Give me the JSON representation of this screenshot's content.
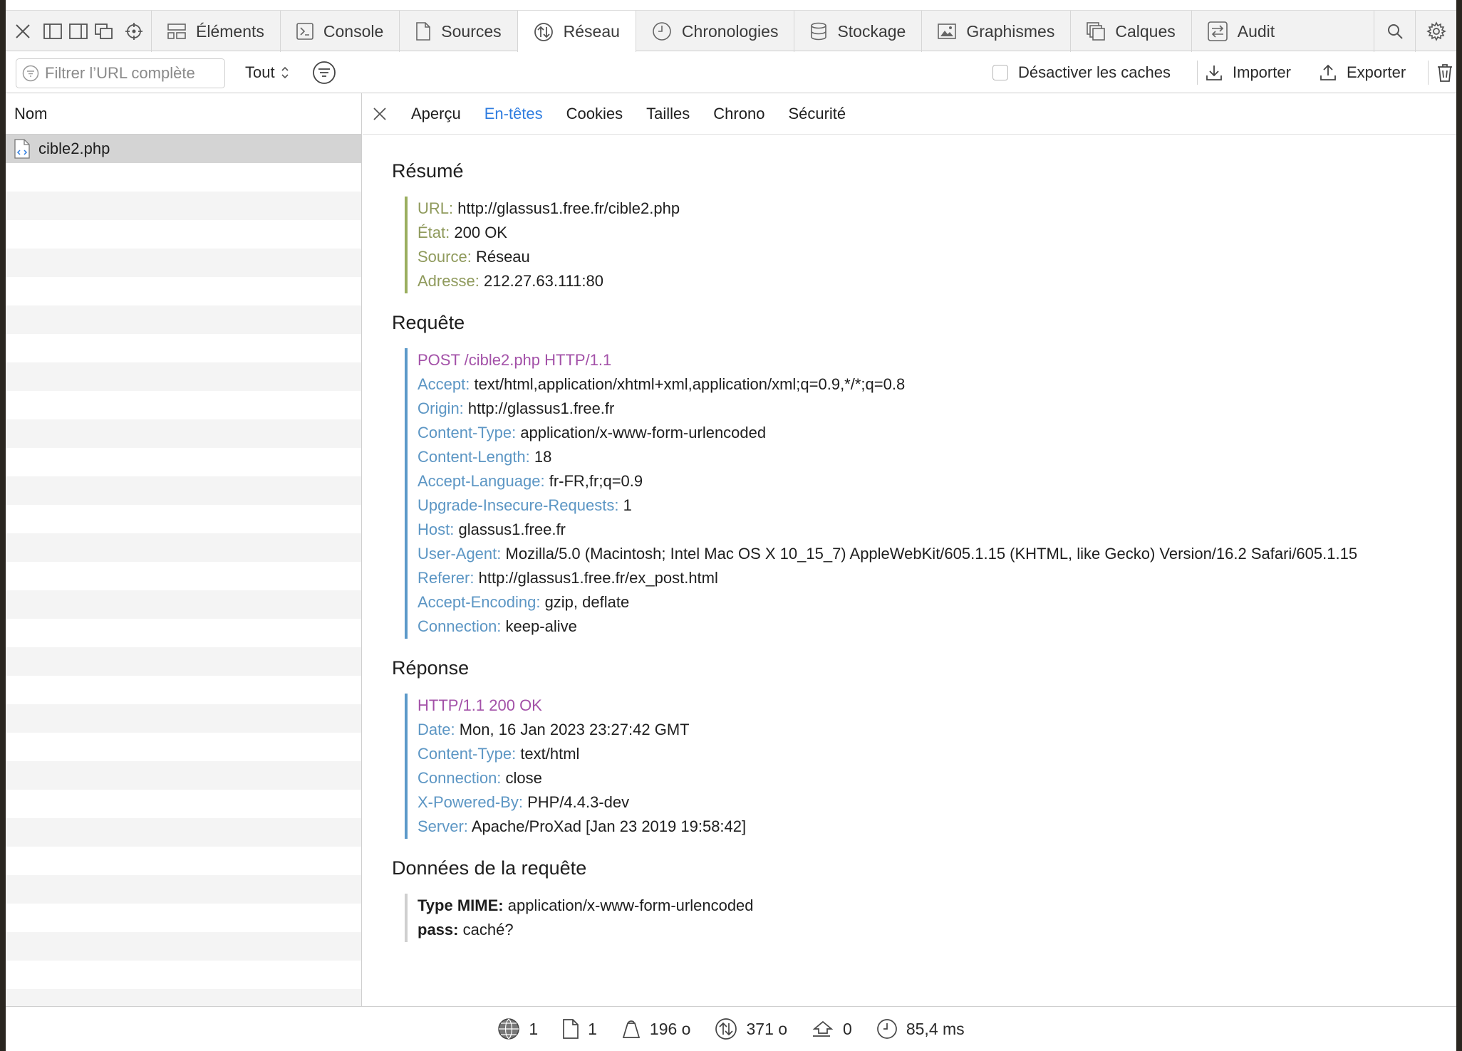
{
  "toolbar": {
    "tabs": [
      {
        "label": "Éléments",
        "icon": "elements-icon"
      },
      {
        "label": "Console",
        "icon": "console-icon"
      },
      {
        "label": "Sources",
        "icon": "sources-icon"
      },
      {
        "label": "Réseau",
        "icon": "network-icon",
        "active": true
      },
      {
        "label": "Chronologies",
        "icon": "timelines-icon"
      },
      {
        "label": "Stockage",
        "icon": "storage-icon"
      },
      {
        "label": "Graphismes",
        "icon": "graphics-icon"
      },
      {
        "label": "Calques",
        "icon": "layers-icon"
      },
      {
        "label": "Audit",
        "icon": "audit-icon"
      }
    ]
  },
  "filterbar": {
    "placeholder": "Filtrer l’URL complète",
    "type_filter": "Tout",
    "disable_cache_label": "Désactiver les caches",
    "import_label": "Importer",
    "export_label": "Exporter"
  },
  "request_list": {
    "header": "Nom",
    "items": [
      {
        "name": "cible2.php"
      }
    ]
  },
  "detail": {
    "tabs": [
      "Aperçu",
      "En-têtes",
      "Cookies",
      "Tailles",
      "Chrono",
      "Sécurité"
    ],
    "active_tab": "En-têtes",
    "summary": {
      "title": "Résumé",
      "rows": [
        {
          "key": "URL:",
          "value": "http://glassus1.free.fr/cible2.php"
        },
        {
          "key": "État:",
          "value": "200 OK"
        },
        {
          "key": "Source:",
          "value": "Réseau"
        },
        {
          "key": "Adresse:",
          "value": "212.27.63.111:80"
        }
      ]
    },
    "request": {
      "title": "Requête",
      "first_line": "POST /cible2.php HTTP/1.1",
      "rows": [
        {
          "key": "Accept:",
          "value": "text/html,application/xhtml+xml,application/xml;q=0.9,*/*;q=0.8"
        },
        {
          "key": "Origin:",
          "value": "http://glassus1.free.fr"
        },
        {
          "key": "Content-Type:",
          "value": "application/x-www-form-urlencoded"
        },
        {
          "key": "Content-Length:",
          "value": "18"
        },
        {
          "key": "Accept-Language:",
          "value": "fr-FR,fr;q=0.9"
        },
        {
          "key": "Upgrade-Insecure-Requests:",
          "value": "1"
        },
        {
          "key": "Host:",
          "value": "glassus1.free.fr"
        },
        {
          "key": "User-Agent:",
          "value": "Mozilla/5.0 (Macintosh; Intel Mac OS X 10_15_7) AppleWebKit/605.1.15 (KHTML, like Gecko) Version/16.2 Safari/605.1.15"
        },
        {
          "key": "Referer:",
          "value": "http://glassus1.free.fr/ex_post.html"
        },
        {
          "key": "Accept-Encoding:",
          "value": "gzip, deflate"
        },
        {
          "key": "Connection:",
          "value": "keep-alive"
        }
      ]
    },
    "response": {
      "title": "Réponse",
      "first_line": "HTTP/1.1 200 OK",
      "rows": [
        {
          "key": "Date:",
          "value": "Mon, 16 Jan 2023 23:27:42 GMT"
        },
        {
          "key": "Content-Type:",
          "value": "text/html"
        },
        {
          "key": "Connection:",
          "value": "close"
        },
        {
          "key": "X-Powered-By:",
          "value": "PHP/4.4.3-dev"
        },
        {
          "key": "Server:",
          "value": "Apache/ProXad [Jan 23 2019 19:58:42]"
        }
      ]
    },
    "request_data": {
      "title": "Données de la requête",
      "rows": [
        {
          "key": "Type MIME:",
          "value": "application/x-www-form-urlencoded"
        },
        {
          "key": "pass:",
          "value": "caché?"
        }
      ]
    }
  },
  "statusbar": {
    "domains": "1",
    "resources": "1",
    "transferred": "196 o",
    "size": "371 o",
    "redirects": "0",
    "time": "85,4 ms"
  },
  "colors": {
    "accent_blue": "#2f7de0",
    "summary_key": "#8f9a5c",
    "header_key": "#5c96c4",
    "first_line": "#a351a8"
  }
}
